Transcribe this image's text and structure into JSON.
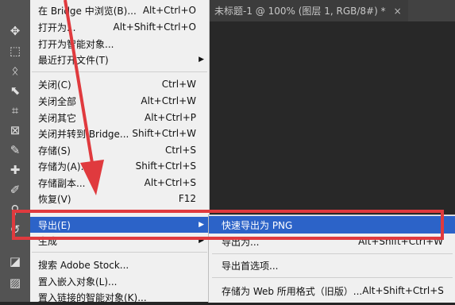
{
  "document_tab": {
    "title": "未标题-1 @ 100% (图层 1, RGB/8#) *",
    "close": "×"
  },
  "toolbar": {
    "tools": [
      {
        "name": "move-tool-icon",
        "glyph": "✥"
      },
      {
        "name": "marquee-tool-icon",
        "glyph": "⬚"
      },
      {
        "name": "lasso-tool-icon",
        "glyph": "ᛟ"
      },
      {
        "name": "quick-select-tool-icon",
        "glyph": "⬉"
      },
      {
        "name": "crop-tool-icon",
        "glyph": "⌗"
      },
      {
        "name": "frame-tool-icon",
        "glyph": "⊠"
      },
      {
        "name": "eyedropper-tool-icon",
        "glyph": "✎"
      },
      {
        "name": "healing-brush-tool-icon",
        "glyph": "✚"
      },
      {
        "name": "brush-tool-icon",
        "glyph": "✐"
      },
      {
        "name": "clone-stamp-tool-icon",
        "glyph": "⚲"
      },
      {
        "name": "history-brush-tool-icon",
        "glyph": "↺"
      },
      {
        "name": "eraser-tool-icon",
        "glyph": "◪"
      },
      {
        "name": "gradient-tool-icon",
        "glyph": "▨"
      }
    ]
  },
  "file_menu": {
    "items": [
      {
        "label": "在 Bridge 中浏览(B)...",
        "shortcut": "Alt+Ctrl+O"
      },
      {
        "label": "打开为...",
        "shortcut": "Alt+Shift+Ctrl+O"
      },
      {
        "label": "打开为智能对象...",
        "shortcut": ""
      },
      {
        "label": "最近打开文件(T)",
        "shortcut": "",
        "submenu": true
      },
      {
        "label": "关闭(C)",
        "shortcut": "Ctrl+W"
      },
      {
        "label": "关闭全部",
        "shortcut": "Alt+Ctrl+W"
      },
      {
        "label": "关闭其它",
        "shortcut": "Alt+Ctrl+P"
      },
      {
        "label": "关闭并转到 Bridge...",
        "shortcut": "Shift+Ctrl+W"
      },
      {
        "label": "存储(S)",
        "shortcut": "Ctrl+S"
      },
      {
        "label": "存储为(A)...",
        "shortcut": "Shift+Ctrl+S"
      },
      {
        "label": "存储副本...",
        "shortcut": "Alt+Ctrl+S"
      },
      {
        "label": "恢复(V)",
        "shortcut": "F12"
      },
      {
        "label": "导出(E)",
        "shortcut": "",
        "submenu": true,
        "highlighted": true
      },
      {
        "label": "生成",
        "shortcut": "",
        "submenu": true
      },
      {
        "label": "搜索 Adobe Stock...",
        "shortcut": ""
      },
      {
        "label": "置入嵌入对象(L)...",
        "shortcut": ""
      },
      {
        "label": "置入链接的智能对象(K)...",
        "shortcut": ""
      }
    ]
  },
  "export_submenu": {
    "items": [
      {
        "label": "快速导出为 PNG",
        "shortcut": "",
        "highlighted": true
      },
      {
        "label": "导出为...",
        "shortcut": "Alt+Shift+Ctrl+W"
      },
      {
        "label": "导出首选项...",
        "shortcut": ""
      },
      {
        "label": "存储为 Web 所用格式（旧版）...",
        "shortcut": "Alt+Shift+Ctrl+S"
      }
    ]
  },
  "colors": {
    "highlight": "#2c63c8",
    "annotation": "#e03a3e",
    "menu_bg": "#f0f0f0"
  }
}
